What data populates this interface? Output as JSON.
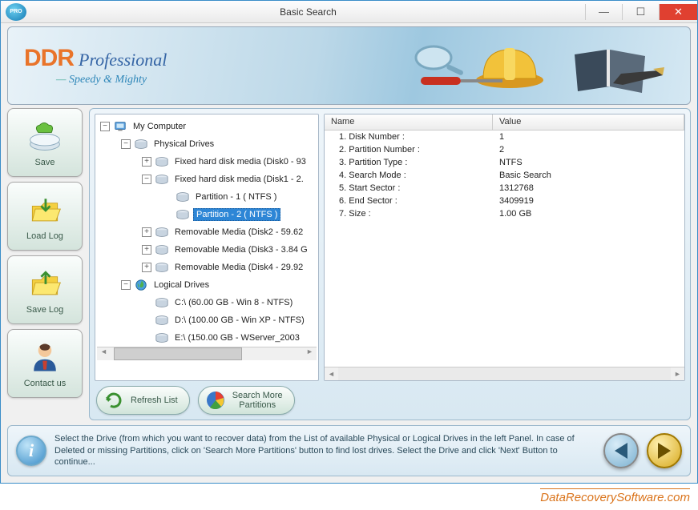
{
  "window": {
    "title": "Basic Search",
    "icon_label": "PRO"
  },
  "banner": {
    "brand": "DDR",
    "product": "Professional",
    "tagline": "Speedy & Mighty"
  },
  "sidebar": [
    {
      "id": "save",
      "label": "Save"
    },
    {
      "id": "loadlog",
      "label": "Load Log"
    },
    {
      "id": "savelog",
      "label": "Save Log"
    },
    {
      "id": "contact",
      "label": "Contact us"
    }
  ],
  "tree": {
    "root": "My Computer",
    "physical_label": "Physical Drives",
    "logical_label": "Logical Drives",
    "physical": [
      {
        "label": "Fixed hard disk media (Disk0 - 93",
        "expanded": false
      },
      {
        "label": "Fixed hard disk media (Disk1 - 2.",
        "expanded": true,
        "children": [
          {
            "label": "Partition - 1 ( NTFS )",
            "selected": false
          },
          {
            "label": "Partition - 2 ( NTFS )",
            "selected": true
          }
        ]
      },
      {
        "label": "Removable Media (Disk2 - 59.62",
        "expanded": false
      },
      {
        "label": "Removable Media (Disk3 - 3.84 G",
        "expanded": false
      },
      {
        "label": "Removable Media (Disk4 - 29.92",
        "expanded": false
      }
    ],
    "logical": [
      {
        "label": "C:\\ (60.00 GB - Win 8 - NTFS)"
      },
      {
        "label": "D:\\ (100.00 GB - Win XP - NTFS)"
      },
      {
        "label": "E:\\ (150.00 GB - WServer_2003"
      }
    ]
  },
  "details": {
    "headers": {
      "name": "Name",
      "value": "Value"
    },
    "rows": [
      {
        "name": "1. Disk Number :",
        "value": "1"
      },
      {
        "name": "2. Partition Number :",
        "value": "2"
      },
      {
        "name": "3. Partition Type :",
        "value": "NTFS"
      },
      {
        "name": "4. Search Mode :",
        "value": "Basic Search"
      },
      {
        "name": "5. Start Sector :",
        "value": "1312768"
      },
      {
        "name": "6. End Sector :",
        "value": "3409919"
      },
      {
        "name": "7. Size :",
        "value": "1.00 GB"
      }
    ]
  },
  "actions": {
    "refresh": "Refresh List",
    "searchmore": "Search More\nPartitions"
  },
  "footer": {
    "message": "Select the Drive (from which you want to recover data) from the List of available Physical or Logical Drives in the left Panel. In case of Deleted or missing Partitions, click on 'Search More Partitions' button to find lost drives. Select the Drive and click 'Next' Button to continue..."
  },
  "watermark": "DataRecoverySoftware.com"
}
